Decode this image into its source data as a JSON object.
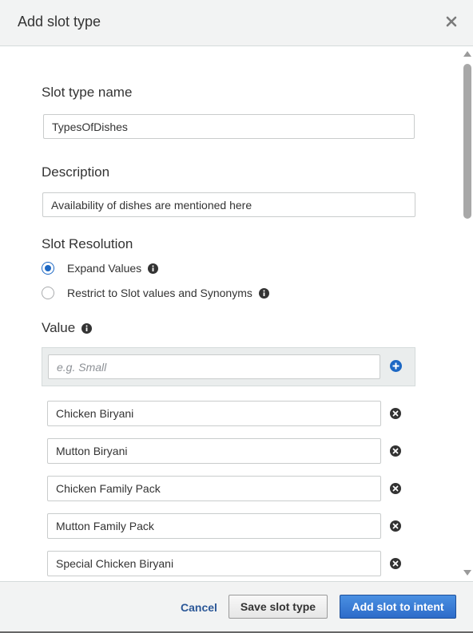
{
  "modal": {
    "title": "Add slot type"
  },
  "form": {
    "slot_type_name_label": "Slot type name",
    "slot_type_name_value": "TypesOfDishes",
    "description_label": "Description",
    "description_value": "Availability of dishes are mentioned here",
    "slot_resolution_label": "Slot Resolution",
    "resolution_options": [
      {
        "label": "Expand Values",
        "selected": true
      },
      {
        "label": "Restrict to Slot values and Synonyms",
        "selected": false
      }
    ],
    "value_label": "Value",
    "value_placeholder": "e.g. Small",
    "values": [
      "Chicken Biryani",
      "Mutton Biryani",
      "Chicken Family Pack",
      "Mutton Family Pack",
      "Special Chicken Biryani"
    ]
  },
  "footer": {
    "cancel_label": "Cancel",
    "save_label": "Save slot type",
    "add_label": "Add slot to intent"
  },
  "colors": {
    "accent": "#1d68c4",
    "primary_button": "#2e6bc9",
    "link": "#2b5797"
  },
  "icons": {
    "close": "close-icon",
    "info": "info-icon",
    "add": "plus-circle-icon",
    "remove": "x-circle-icon"
  }
}
